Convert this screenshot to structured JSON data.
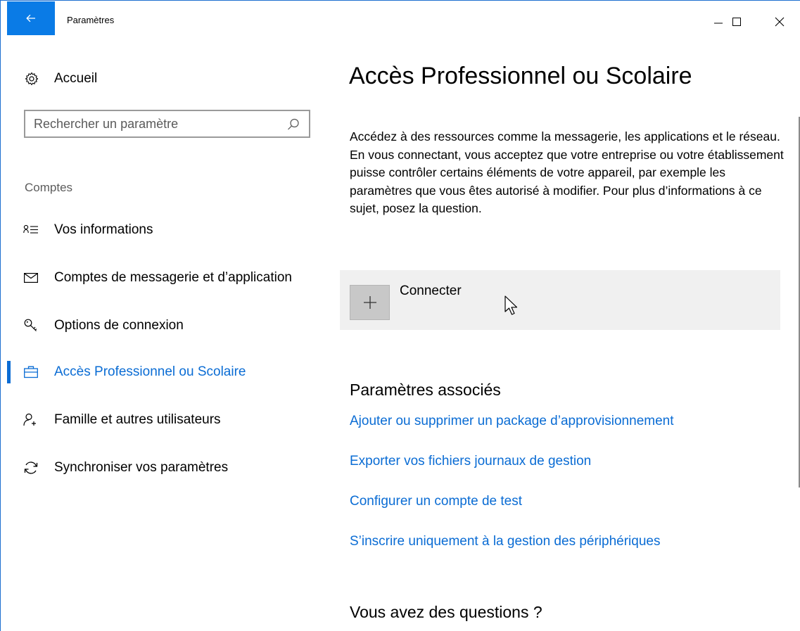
{
  "window": {
    "title": "Paramètres",
    "accent_color": "#0a7be6",
    "link_color": "#0a6cd4"
  },
  "sidebar": {
    "home_label": "Accueil",
    "search_placeholder": "Rechercher un paramètre",
    "section_label": "Comptes",
    "items": [
      {
        "label": "Vos informations",
        "icon": "contact-card-icon",
        "active": false
      },
      {
        "label": "Comptes de messagerie et d’application",
        "icon": "mail-icon",
        "active": false
      },
      {
        "label": "Options de connexion",
        "icon": "key-icon",
        "active": false
      },
      {
        "label": "Accès Professionnel ou Scolaire",
        "icon": "briefcase-icon",
        "active": true
      },
      {
        "label": "Famille et autres utilisateurs",
        "icon": "add-person-icon",
        "active": false
      },
      {
        "label": "Synchroniser vos paramètres",
        "icon": "sync-icon",
        "active": false
      }
    ]
  },
  "main": {
    "title": "Accès Professionnel ou Scolaire",
    "description": "Accédez à des ressources comme la messagerie, les applications et le réseau. En vous connectant, vous acceptez que votre entreprise ou votre établissement puisse contrôler certains éléments de votre appareil, par exemple les paramètres que vous êtes autorisé à modifier. Pour plus d’informations à ce sujet, posez la question.",
    "connect_label": "Connecter",
    "related_title": "Paramètres associés",
    "related_links": [
      "Ajouter ou supprimer un package d’approvisionnement",
      "Exporter vos fichiers journaux de gestion",
      "Configurer un compte de test",
      "S’inscrire uniquement à la gestion des périphériques"
    ],
    "questions_title": "Vous avez des questions ?"
  }
}
